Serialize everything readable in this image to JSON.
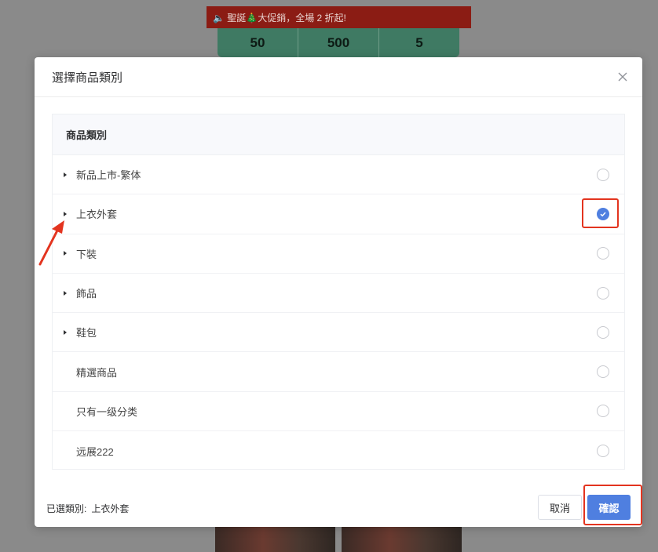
{
  "background": {
    "banner_text": "🔈 聖誕🎄大促銷，全場 2 折起!",
    "stats": [
      "50",
      "500",
      "5"
    ]
  },
  "modal": {
    "title": "選擇商品類別",
    "close_icon": "close-icon",
    "table_header": "商品類別",
    "rows": [
      {
        "label": "新品上市-繁体",
        "expandable": true,
        "checked": false
      },
      {
        "label": "上衣外套",
        "expandable": true,
        "checked": true
      },
      {
        "label": "下裝",
        "expandable": true,
        "checked": false
      },
      {
        "label": "飾品",
        "expandable": true,
        "checked": false
      },
      {
        "label": "鞋包",
        "expandable": true,
        "checked": false
      },
      {
        "label": "精選商品",
        "expandable": false,
        "checked": false
      },
      {
        "label": "只有一级分类",
        "expandable": false,
        "checked": false
      },
      {
        "label": "远展222",
        "expandable": false,
        "checked": false
      }
    ],
    "selected_label": "已選類別:",
    "selected_value": "上衣外套",
    "cancel_label": "取消",
    "confirm_label": "確認"
  },
  "colors": {
    "accent": "#4f7fe0",
    "annotation_red": "#e3341f"
  }
}
